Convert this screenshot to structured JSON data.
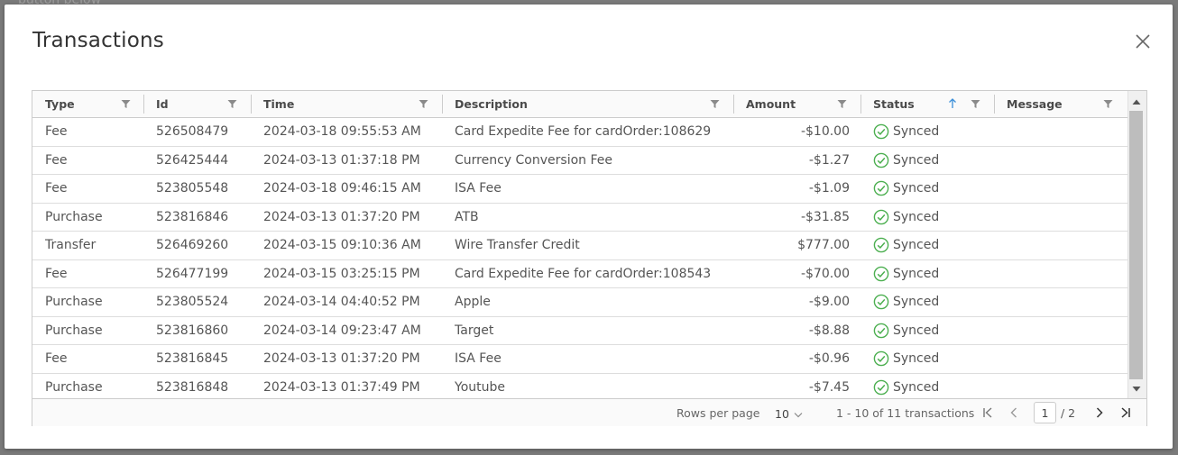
{
  "backdrop": {
    "text": "button below"
  },
  "modal": {
    "title": "Transactions"
  },
  "columns": {
    "type": "Type",
    "id": "Id",
    "time": "Time",
    "description": "Description",
    "amount": "Amount",
    "status": "Status",
    "message": "Message"
  },
  "sort": {
    "column": "Status",
    "direction": "ascending"
  },
  "rows": [
    {
      "type": "Fee",
      "id": "526508479",
      "time": "2024-03-18 09:55:53 AM",
      "description": "Card Expedite Fee for cardOrder:108629",
      "amount": "-$10.00",
      "status": "Synced",
      "message": ""
    },
    {
      "type": "Fee",
      "id": "526425444",
      "time": "2024-03-13 01:37:18 PM",
      "description": "Currency Conversion Fee",
      "amount": "-$1.27",
      "status": "Synced",
      "message": ""
    },
    {
      "type": "Fee",
      "id": "523805548",
      "time": "2024-03-18 09:46:15 AM",
      "description": "ISA Fee",
      "amount": "-$1.09",
      "status": "Synced",
      "message": ""
    },
    {
      "type": "Purchase",
      "id": "523816846",
      "time": "2024-03-13 01:37:20 PM",
      "description": "ATB",
      "amount": "-$31.85",
      "status": "Synced",
      "message": ""
    },
    {
      "type": "Transfer",
      "id": "526469260",
      "time": "2024-03-15 09:10:36 AM",
      "description": "Wire Transfer Credit",
      "amount": "$777.00",
      "status": "Synced",
      "message": ""
    },
    {
      "type": "Fee",
      "id": "526477199",
      "time": "2024-03-15 03:25:15 PM",
      "description": "Card Expedite Fee for cardOrder:108543",
      "amount": "-$70.00",
      "status": "Synced",
      "message": ""
    },
    {
      "type": "Purchase",
      "id": "523805524",
      "time": "2024-03-14 04:40:52 PM",
      "description": "Apple",
      "amount": "-$9.00",
      "status": "Synced",
      "message": ""
    },
    {
      "type": "Purchase",
      "id": "523816860",
      "time": "2024-03-14 09:23:47 AM",
      "description": "Target",
      "amount": "-$8.88",
      "status": "Synced",
      "message": ""
    },
    {
      "type": "Fee",
      "id": "523816845",
      "time": "2024-03-13 01:37:20 PM",
      "description": "ISA Fee",
      "amount": "-$0.96",
      "status": "Synced",
      "message": ""
    },
    {
      "type": "Purchase",
      "id": "523816848",
      "time": "2024-03-13 01:37:49 PM",
      "description": "Youtube",
      "amount": "-$7.45",
      "status": "Synced",
      "message": ""
    }
  ],
  "footer": {
    "rows_per_page_label": "Rows per page",
    "rows_per_page_value": "10",
    "range_text": "1 - 10 of 11 transactions",
    "current_page": "1",
    "total_pages": "/ 2"
  },
  "colors": {
    "synced_green": "#4caf50",
    "sort_arrow_blue": "#3b8fd9",
    "text": "#555555"
  },
  "icons": {
    "close": "close-icon",
    "filter": "filter-icon",
    "sort": "sort-ascending-icon",
    "status": "check-circle-icon",
    "first_page": "first-page-icon",
    "prev_page": "prev-page-icon",
    "next_page": "next-page-icon",
    "last_page": "last-page-icon"
  }
}
